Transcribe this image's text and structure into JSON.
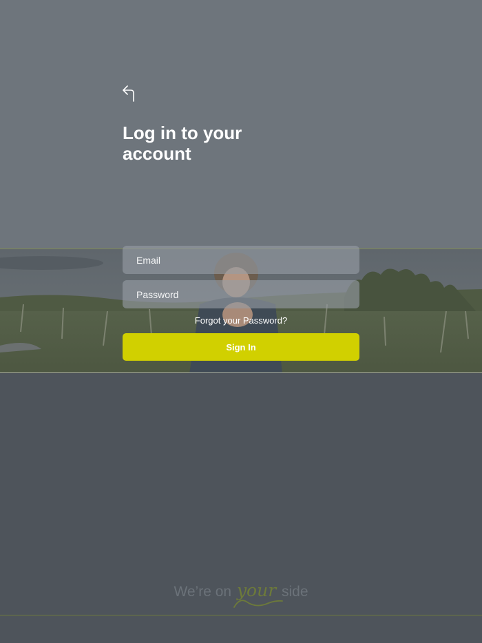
{
  "header": {
    "back_icon": "back-arrow-icon",
    "title": "Log in to your account"
  },
  "form": {
    "email_placeholder": "Email",
    "password_placeholder": "Password",
    "forgot_label": "Forgot your Password?",
    "signin_label": "Sign In"
  },
  "footer": {
    "tagline_before": "We’re on",
    "tagline_script": "your",
    "tagline_after": "side"
  },
  "colors": {
    "accent": "#d1d000",
    "top_background": "#6e757c",
    "bottom_background": "#4e545b",
    "script_green": "#6d7a3a"
  }
}
